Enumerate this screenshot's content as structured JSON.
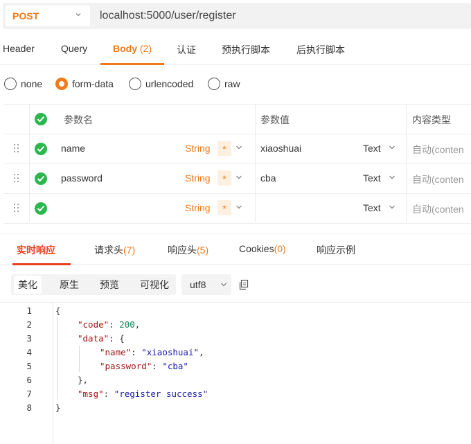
{
  "request": {
    "method": "POST",
    "url": "localhost:5000/user/register"
  },
  "req_tabs": {
    "header": "Header",
    "query": "Query",
    "body": "Body",
    "body_count": "(2)",
    "auth": "认证",
    "pre_script": "预执行脚本",
    "post_script": "后执行脚本"
  },
  "body_types": {
    "none": "none",
    "form_data": "form-data",
    "urlencoded": "urlencoded",
    "raw": "raw",
    "selected": "form-data"
  },
  "params_table": {
    "headers": {
      "name": "参数名",
      "value": "参数值",
      "content_type": "内容类型"
    },
    "rows": [
      {
        "name": "name",
        "type": "String",
        "required": "*",
        "value": "xiaoshuai",
        "value_type": "Text",
        "content_type": "自动(conten"
      },
      {
        "name": "password",
        "type": "String",
        "required": "*",
        "value": "cba",
        "value_type": "Text",
        "content_type": "自动(conten"
      },
      {
        "name": "",
        "type": "String",
        "required": "*",
        "value": "",
        "value_type": "Text",
        "content_type": "自动(conten"
      }
    ]
  },
  "resp_tabs": {
    "live": "实时响应",
    "req_headers": "请求头",
    "req_headers_count": "(7)",
    "resp_headers": "响应头",
    "resp_headers_count": "(5)",
    "cookies": "Cookies",
    "cookies_count": "(0)",
    "examples": "响应示例"
  },
  "view": {
    "pretty": "美化",
    "raw": "原生",
    "preview": "预览",
    "visualize": "可视化",
    "encoding": "utf8"
  },
  "code": {
    "line_numbers": [
      "1",
      "2",
      "3",
      "4",
      "5",
      "6",
      "7",
      "8"
    ],
    "open_brace": "{",
    "code_key": "\"code\"",
    "code_val": "200",
    "data_key": "\"data\"",
    "name_key": "\"name\"",
    "name_val": "\"xiaoshuai\"",
    "password_key": "\"password\"",
    "password_val": "\"cba\"",
    "msg_key": "\"msg\"",
    "msg_val": "\"register success\"",
    "close_brace": "}"
  },
  "colors": {
    "accent": "#f07a1a",
    "active_resp": "#e8401c",
    "check_green": "#2bb74d"
  }
}
